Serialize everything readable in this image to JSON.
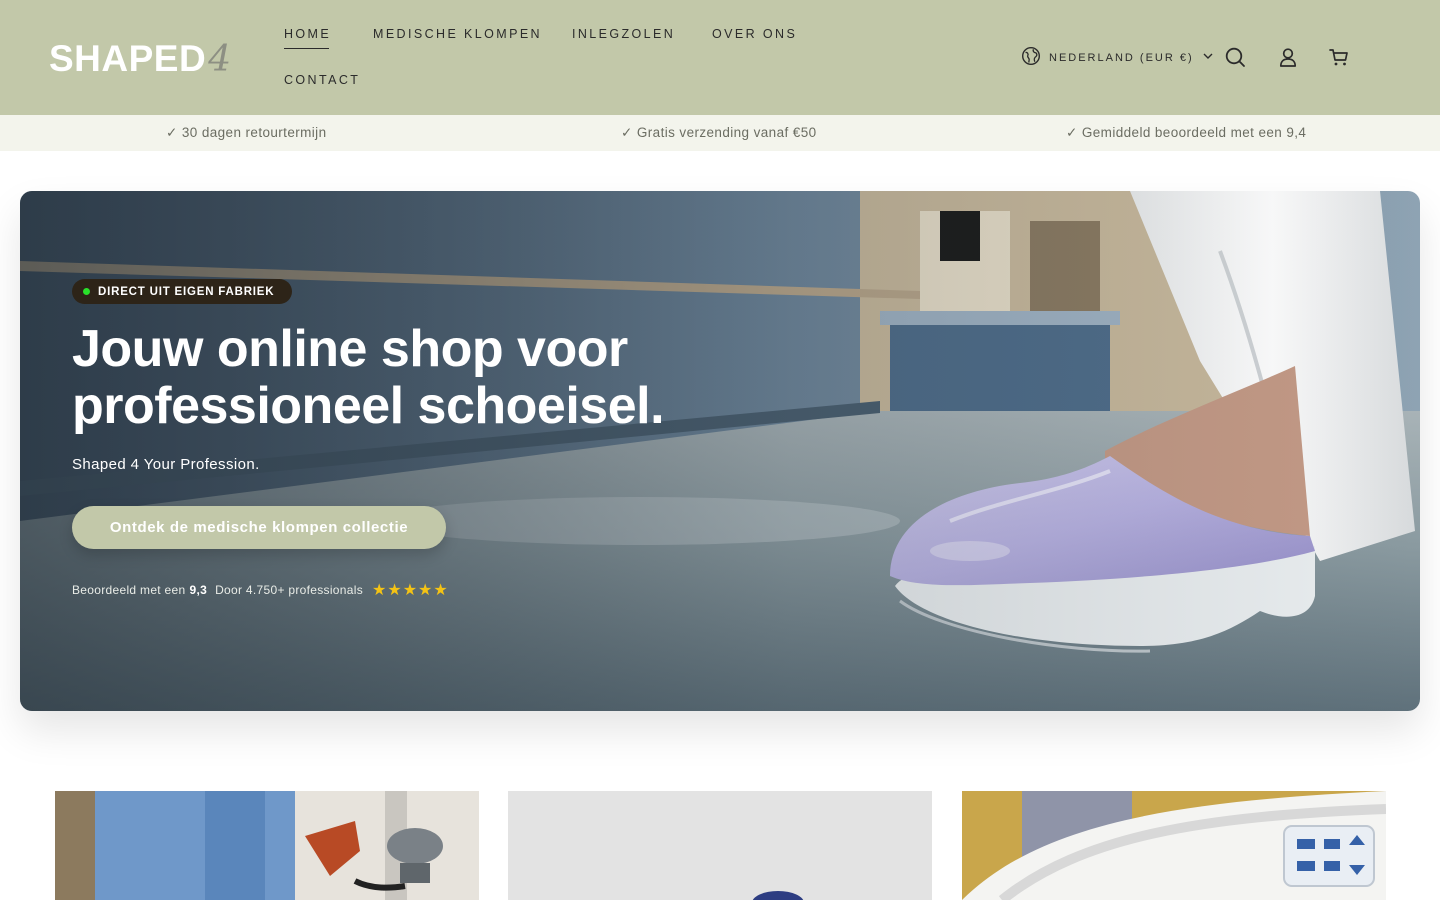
{
  "brand": {
    "name": "SHAPED",
    "suffix": "4"
  },
  "nav": {
    "items": [
      {
        "label": "HOME",
        "active": true
      },
      {
        "label": "MEDISCHE KLOMPEN",
        "active": false
      },
      {
        "label": "INLEGZOLEN",
        "active": false
      },
      {
        "label": "OVER ONS",
        "active": false
      },
      {
        "label": "CONTACT",
        "active": false
      }
    ]
  },
  "header": {
    "locale_label": "NEDERLAND (EUR €)",
    "icons": [
      "globe-icon",
      "chevron-down-icon",
      "search-icon",
      "account-icon",
      "cart-icon"
    ]
  },
  "usp": {
    "items": [
      "✓ 30 dagen retourtermijn",
      "✓ Gratis verzending vanaf €50",
      "✓ Gemiddeld beoordeeld met een 9,4"
    ]
  },
  "hero": {
    "badge": "DIRECT UIT EIGEN FABRIEK",
    "title": "Jouw online shop voor professioneel schoeisel.",
    "subtitle": "Shaped 4 Your Profession.",
    "cta": "Ontdek de medische klompen collectie",
    "rating_prefix": "Beoordeeld met een",
    "rating_value": "9,3",
    "rating_by": "Door 4.750+ professionals",
    "stars": "★★★★★"
  },
  "colors": {
    "header_bg": "#c2c8a9",
    "usp_bg": "#f3f4ec",
    "badge_bg": "#2d2418",
    "badge_dot": "#29e02a",
    "star": "#f4c315",
    "clog": "#b8b2e2"
  }
}
